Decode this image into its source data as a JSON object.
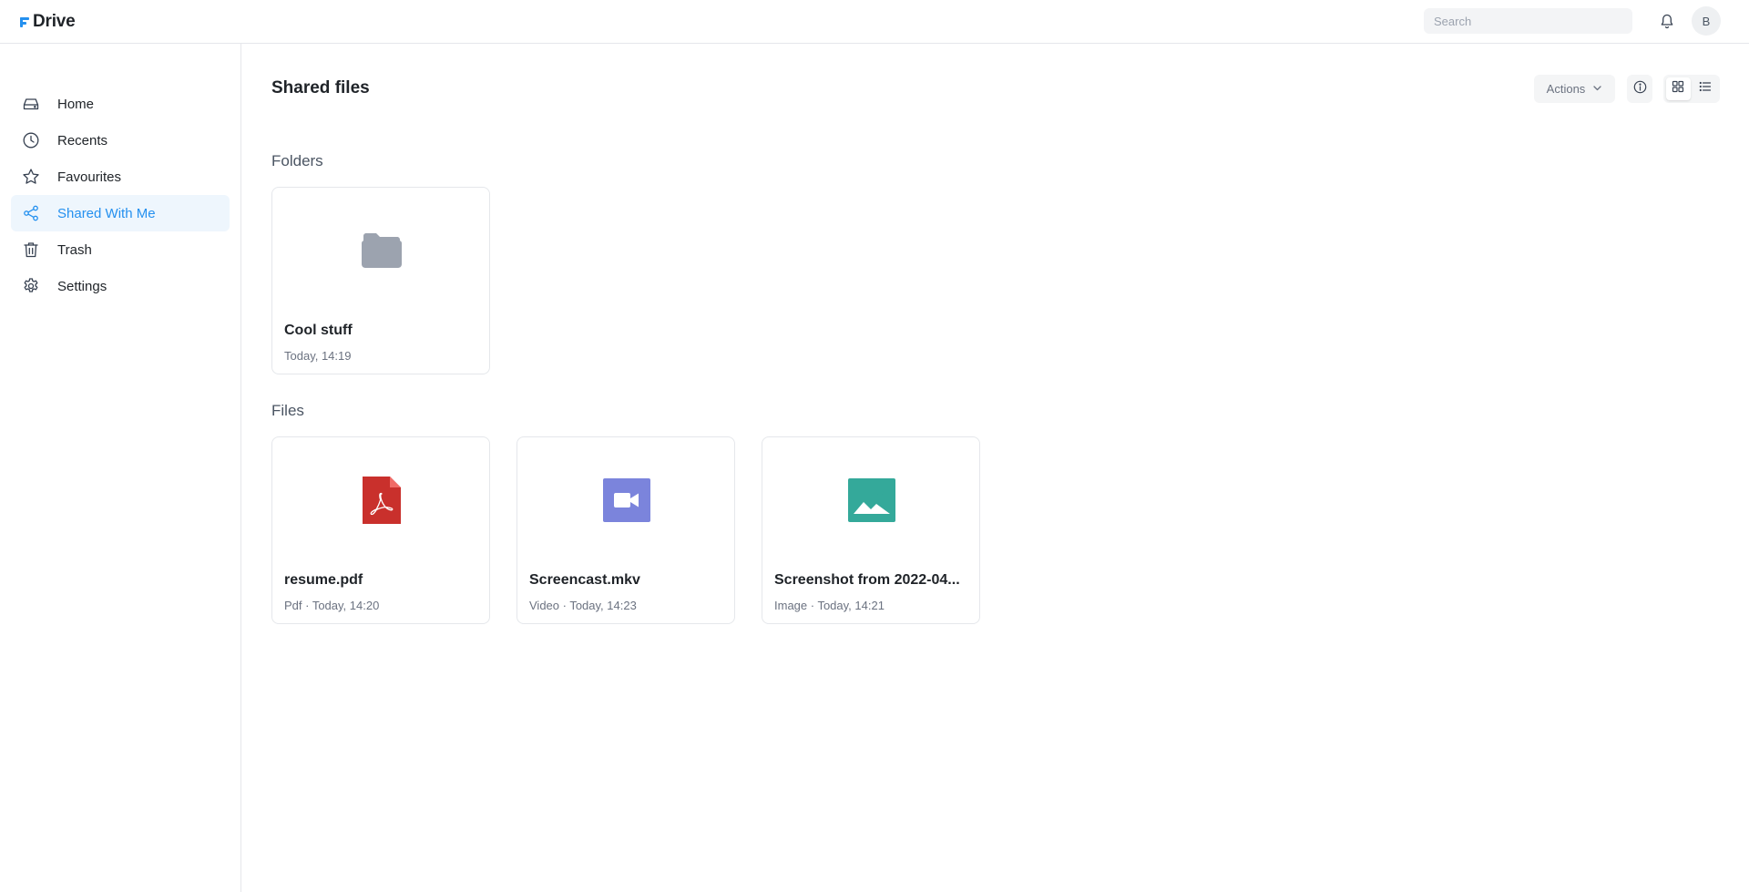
{
  "app": {
    "name": "Drive",
    "brand_color": "#2490ef"
  },
  "header": {
    "search_placeholder": "Search",
    "notifications_icon": "bell-icon",
    "avatar_initial": "B"
  },
  "sidebar": {
    "items": [
      {
        "label": "Home",
        "icon": "drive-icon",
        "active": false
      },
      {
        "label": "Recents",
        "icon": "clock-icon",
        "active": false
      },
      {
        "label": "Favourites",
        "icon": "star-icon",
        "active": false
      },
      {
        "label": "Shared With Me",
        "icon": "share-icon",
        "active": true
      },
      {
        "label": "Trash",
        "icon": "trash-icon",
        "active": false
      },
      {
        "label": "Settings",
        "icon": "gear-icon",
        "active": false
      }
    ]
  },
  "main": {
    "title": "Shared files",
    "actions_label": "Actions",
    "view_mode": "grid",
    "folders_heading": "Folders",
    "files_heading": "Files",
    "folders": [
      {
        "name": "Cool stuff",
        "meta": "Today, 14:19",
        "icon": "folder-icon",
        "color": "#9ca3af"
      }
    ],
    "files": [
      {
        "name": "resume.pdf",
        "meta": "Pdf · Today, 14:20",
        "icon": "pdf-icon",
        "color": "#c9302c"
      },
      {
        "name": "Screencast.mkv",
        "meta": "Video · Today, 14:23",
        "icon": "video-icon",
        "color": "#7b84dc"
      },
      {
        "name": "Screenshot from 2022-04...",
        "meta": "Image · Today, 14:21",
        "icon": "image-icon",
        "color": "#34a99a"
      }
    ]
  }
}
